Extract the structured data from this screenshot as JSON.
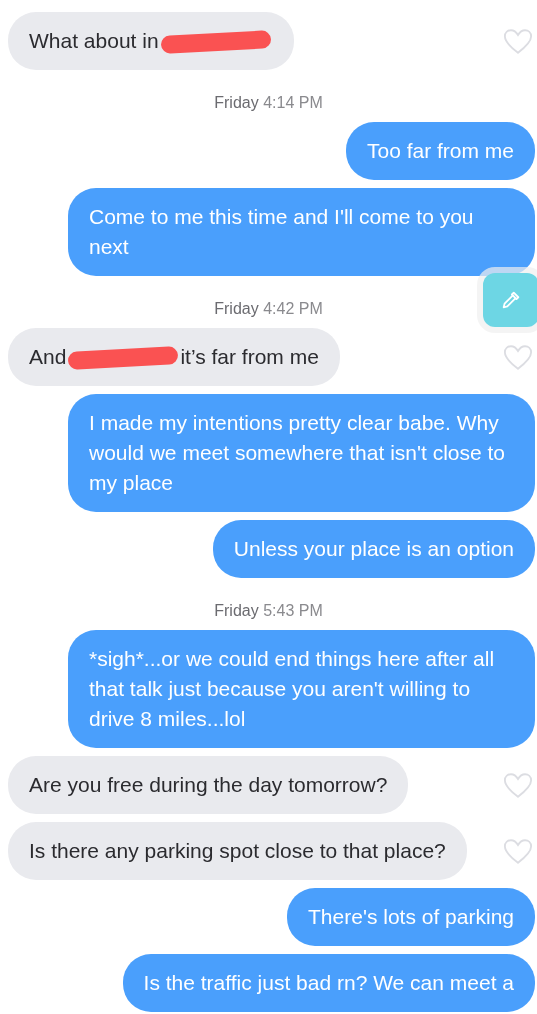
{
  "thread": [
    {
      "kind": "incoming",
      "text": "What about in",
      "redacted": true,
      "liked": false
    },
    {
      "kind": "timestamp",
      "day": "Friday",
      "time": "4:14 PM"
    },
    {
      "kind": "outgoing",
      "text": "Too far from me"
    },
    {
      "kind": "outgoing",
      "text": "Come to me this time and I'll come to you next"
    },
    {
      "kind": "timestamp",
      "day": "Friday",
      "time": "4:42 PM"
    },
    {
      "kind": "incoming",
      "text": "And",
      "redacted": true,
      "text_after": "it’s far from me",
      "liked": false
    },
    {
      "kind": "outgoing",
      "text": "I made my intentions pretty clear babe. Why would we meet somewhere that isn't close to my place"
    },
    {
      "kind": "outgoing",
      "text": "Unless your place is an option"
    },
    {
      "kind": "timestamp",
      "day": "Friday",
      "time": "5:43 PM"
    },
    {
      "kind": "outgoing",
      "text": "*sigh*...or we could end things here after all that talk just because you aren't willing to drive 8 miles...lol"
    },
    {
      "kind": "incoming",
      "text": "Are you free during the day tomorrow?",
      "liked": false
    },
    {
      "kind": "incoming",
      "text": "Is there any parking spot close to that place?",
      "liked": false
    },
    {
      "kind": "outgoing",
      "text": "There's lots of parking"
    },
    {
      "kind": "outgoing",
      "text": "Is the traffic just bad rn? We can meet a"
    }
  ],
  "floating_button": {
    "kind": "eyedropper"
  }
}
